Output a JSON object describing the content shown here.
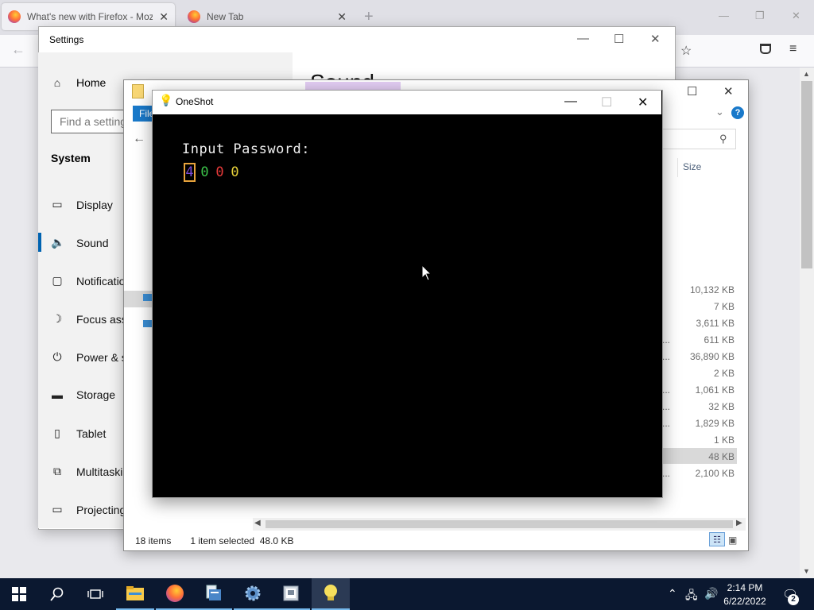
{
  "firefox": {
    "tabs": [
      {
        "title": "What's new with Firefox - Mozil",
        "close": "✕"
      },
      {
        "title": "New Tab",
        "close": "✕"
      }
    ],
    "new_tab_glyph": "+",
    "back_glyph": "←"
  },
  "settings": {
    "title": "Settings",
    "home_label": "Home",
    "find_placeholder": "Find a setting",
    "section": "System",
    "items": [
      {
        "label": "Display",
        "icon": "display-icon"
      },
      {
        "label": "Sound",
        "icon": "speaker-icon"
      },
      {
        "label": "Notifications & actions",
        "icon": "notifications-icon"
      },
      {
        "label": "Focus assist",
        "icon": "moon-icon"
      },
      {
        "label": "Power & sleep",
        "icon": "power-icon"
      },
      {
        "label": "Storage",
        "icon": "storage-icon"
      },
      {
        "label": "Tablet",
        "icon": "tablet-icon"
      },
      {
        "label": "Multitasking",
        "icon": "multitasking-icon"
      },
      {
        "label": "Projecting to this PC",
        "icon": "projecting-icon"
      }
    ],
    "page_heading": "Sound"
  },
  "explorer": {
    "file_tab": "File",
    "size_header": "Size",
    "sizes": [
      "10,132 KB",
      "7 KB",
      "3,611 KB",
      "611 KB",
      "36,890 KB",
      "2 KB",
      "1,061 KB",
      "32 KB",
      "1,829 KB",
      "1 KB",
      "48 KB",
      "2,100 KB"
    ],
    "selected_size": "48 KB",
    "status": {
      "items": "18 items",
      "selected": "1 item selected",
      "size": "48.0 KB"
    }
  },
  "oneshot": {
    "title": "OneShot",
    "prompt": "Input Password:",
    "digits": [
      {
        "value": "4",
        "color": "#7b4bd8"
      },
      {
        "value": "0",
        "color": "#3cc34a"
      },
      {
        "value": "0",
        "color": "#e83a3a"
      },
      {
        "value": "0",
        "color": "#e8d23a"
      }
    ],
    "selected_digit_border": "#e8a33c"
  },
  "taskbar": {
    "apps": [
      "start-icon",
      "search-icon",
      "task-view-icon",
      "file-explorer-icon",
      "firefox-icon",
      "file-manager-icon",
      "settings-gear-icon",
      "document-viewer-icon",
      "oneshot-bulb-icon"
    ],
    "time": "2:14 PM",
    "date": "6/22/2022",
    "notification_count": "2"
  }
}
